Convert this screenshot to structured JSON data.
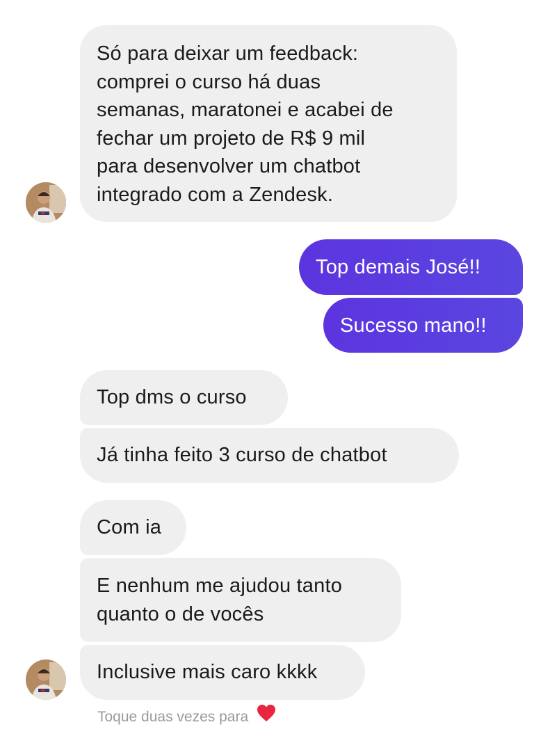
{
  "messages": [
    {
      "from": "them",
      "text": "Só para deixar um feedback:\ncomprei o curso há duas\nsemanas, maratonei e acabei de\nfechar um projeto de R$ 9 mil\npara desenvolver um chatbot\nintegrado com a Zendesk."
    },
    {
      "from": "me",
      "text": "Top demais José!!"
    },
    {
      "from": "me",
      "text": "Sucesso mano!!"
    },
    {
      "from": "them",
      "text": "Top dms o curso"
    },
    {
      "from": "them",
      "text": "Já tinha feito 3 curso de chatbot"
    },
    {
      "from": "them",
      "text": "Com ia"
    },
    {
      "from": "them",
      "text": "E nenhum me ajudou tanto\nquanto o de vocês"
    },
    {
      "from": "them",
      "text": "Inclusive mais caro kkkk"
    }
  ],
  "footer": {
    "hint": "Toque duas vezes para",
    "reaction_icon": "heart-icon"
  },
  "colors": {
    "incoming_bubble": "#efefef",
    "outgoing_bubble": "#5b38e0",
    "heart": "#e8263f"
  }
}
